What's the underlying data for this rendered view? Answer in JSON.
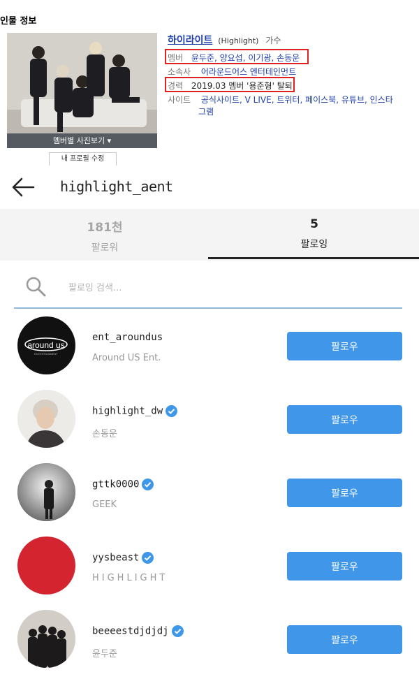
{
  "profile": {
    "section_title": "인물 정보",
    "photo_bar_label": "멤버별 사진보기 ▾",
    "edit_button": "내 프로필 수정",
    "name": "하이라이트",
    "name_eng": "(Highlight)",
    "role": "가수",
    "members_label": "멤버",
    "members_value": "윤두준, 양요섭, 이기광, 손동운",
    "agency_label": "소속사",
    "agency_value": "어라운드어스 엔터테인먼트",
    "history_label": "경력",
    "history_value": "2019.03 멤버 '용준형' 탈퇴",
    "site_label": "사이트",
    "site_value_line1": "공식사이트, V LIVE, 트위터, 페이스북, 유튜브, 인스타",
    "site_value_line2": "그램",
    "highlight_color": "#e02020",
    "link_color": "#1f3fa8"
  },
  "instagram": {
    "handle": "highlight_aent",
    "tabs": [
      {
        "count": "181천",
        "label": "팔로워"
      },
      {
        "count": "5",
        "label": "팔로잉"
      }
    ],
    "search_placeholder": "팔로잉 검색...",
    "accent_color": "#4096e8",
    "following": [
      {
        "username": "ent_aroundus",
        "subtitle": "Around US Ent.",
        "verified": false,
        "button": "팔로우",
        "avatar_text": "around us",
        "avatar_subtext": "ENTERTAINMENT"
      },
      {
        "username": "highlight_dw",
        "subtitle": "손동운",
        "verified": true,
        "button": "팔로우"
      },
      {
        "username": "gttk0000",
        "subtitle": "GEEK",
        "verified": true,
        "button": "팔로우"
      },
      {
        "username": "yysbeast",
        "subtitle": "HIGHLIGHT",
        "verified": true,
        "button": "팔로우"
      },
      {
        "username": "beeeestdjdjdj",
        "subtitle": "윤두준",
        "verified": true,
        "button": "팔로우"
      }
    ]
  }
}
